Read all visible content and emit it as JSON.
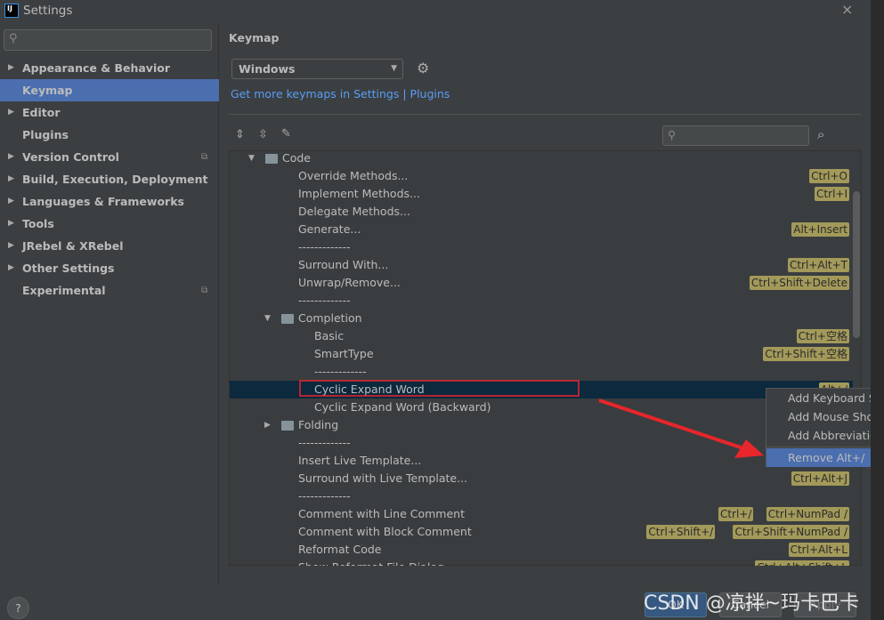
{
  "window": {
    "title": "Settings",
    "logo": "IJ",
    "close": "×"
  },
  "sidebar": {
    "items": [
      {
        "label": "Appearance & Behavior",
        "arrow": true
      },
      {
        "label": "Keymap",
        "selected": true
      },
      {
        "label": "Editor",
        "arrow": true
      },
      {
        "label": "Plugins"
      },
      {
        "label": "Version Control",
        "arrow": true,
        "project": true
      },
      {
        "label": "Build, Execution, Deployment",
        "arrow": true
      },
      {
        "label": "Languages & Frameworks",
        "arrow": true
      },
      {
        "label": "Tools",
        "arrow": true
      },
      {
        "label": "JRebel & XRebel",
        "arrow": true
      },
      {
        "label": "Other Settings",
        "arrow": true
      },
      {
        "label": "Experimental",
        "project": true
      }
    ]
  },
  "main": {
    "heading": "Keymap",
    "keymap_select": "Windows",
    "link_text": "Get more keymaps in Settings | Plugins"
  },
  "tree": {
    "rows": [
      {
        "label": "Code",
        "level": 0,
        "folder": true,
        "expanded": true,
        "shortcuts": []
      },
      {
        "label": "Override Methods...",
        "level": 1,
        "shortcuts": [
          "Ctrl+O"
        ]
      },
      {
        "label": "Implement Methods...",
        "level": 1,
        "shortcuts": [
          "Ctrl+I"
        ]
      },
      {
        "label": "Delegate Methods...",
        "level": 1,
        "shortcuts": []
      },
      {
        "label": "Generate...",
        "level": 1,
        "shortcuts": [
          "Alt+Insert"
        ]
      },
      {
        "label": "-------------",
        "level": 1,
        "shortcuts": []
      },
      {
        "label": "Surround With...",
        "level": 1,
        "shortcuts": [
          "Ctrl+Alt+T"
        ]
      },
      {
        "label": "Unwrap/Remove...",
        "level": 1,
        "shortcuts": [
          "Ctrl+Shift+Delete"
        ]
      },
      {
        "label": "-------------",
        "level": 1,
        "shortcuts": []
      },
      {
        "label": "Completion",
        "level": 1,
        "folder": true,
        "expanded": true,
        "shortcuts": []
      },
      {
        "label": "Basic",
        "level": 2,
        "shortcuts": [
          "Ctrl+空格"
        ]
      },
      {
        "label": "SmartType",
        "level": 2,
        "shortcuts": [
          "Ctrl+Shift+空格"
        ]
      },
      {
        "label": "-------------",
        "level": 2,
        "shortcuts": []
      },
      {
        "label": "Cyclic Expand Word",
        "level": 2,
        "selected": true,
        "shortcuts": [
          "Alt+/"
        ]
      },
      {
        "label": "Cyclic Expand Word (Backward)",
        "level": 2,
        "shortcuts": []
      },
      {
        "label": "Folding",
        "level": 1,
        "folder": true,
        "expanded": false,
        "shortcuts": []
      },
      {
        "label": "-------------",
        "level": 1,
        "shortcuts": []
      },
      {
        "label": "Insert Live Template...",
        "level": 1,
        "shortcuts": []
      },
      {
        "label": "Surround with Live Template...",
        "level": 1,
        "shortcuts": [
          "Ctrl+Alt+J"
        ]
      },
      {
        "label": "-------------",
        "level": 1,
        "shortcuts": []
      },
      {
        "label": "Comment with Line Comment",
        "level": 1,
        "shortcuts": [
          "Ctrl+/",
          "Ctrl+NumPad /"
        ]
      },
      {
        "label": "Comment with Block Comment",
        "level": 1,
        "shortcuts": [
          "Ctrl+Shift+/",
          "Ctrl+Shift+NumPad /"
        ]
      },
      {
        "label": "Reformat Code",
        "level": 1,
        "shortcuts": [
          "Ctrl+Alt+L"
        ]
      },
      {
        "label": "Show Reformat File Dialog",
        "level": 1,
        "shortcuts": [
          "Ctrl+Alt+Shift+L"
        ]
      }
    ]
  },
  "context_menu": {
    "items": [
      {
        "label": "Add Keyboard Shortcut"
      },
      {
        "label": "Add Mouse Shortcut"
      },
      {
        "label": "Add Abbreviation"
      },
      {
        "label": "Remove Alt+/",
        "selected": true
      }
    ]
  },
  "footer": {
    "help": "?",
    "ok": "OK",
    "cancel": "Cancel",
    "apply": "Apply"
  },
  "watermark": "CSDN @凉拌~玛卡巴卡",
  "colors": {
    "accent": "#4b6eaf",
    "selected_row": "#0d293e",
    "shortcut_badge": "#a39a5a",
    "link": "#589df6",
    "annotation": "#e8262b"
  }
}
